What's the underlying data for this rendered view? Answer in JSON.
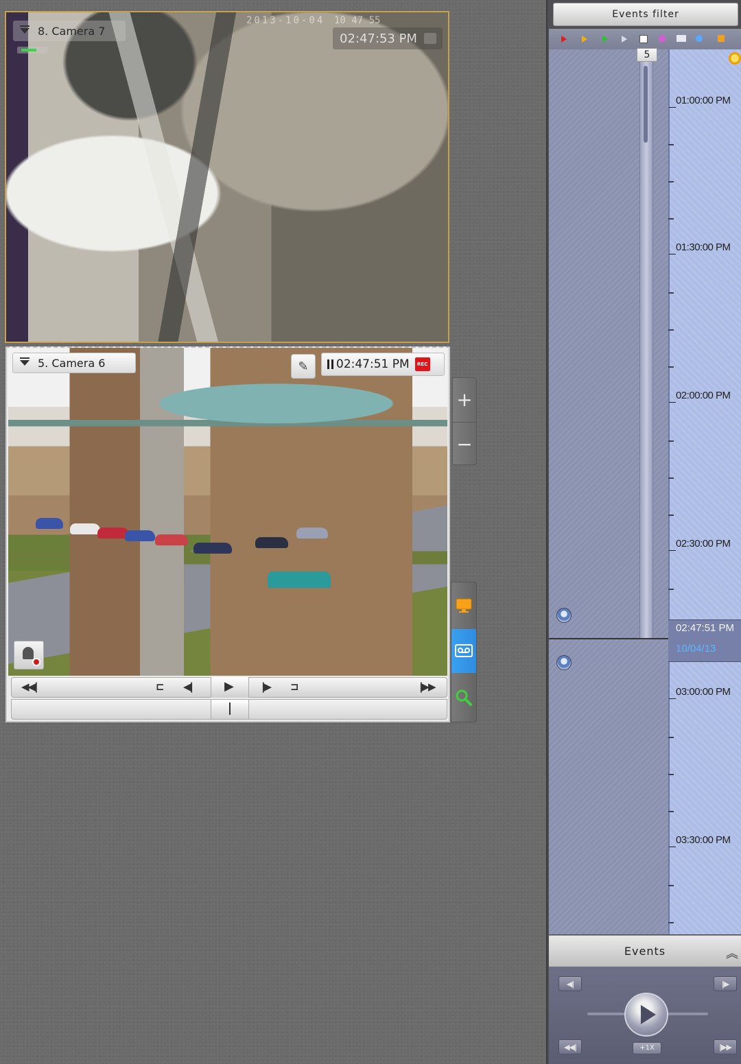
{
  "cameras": {
    "camera7": {
      "label": "8. Camera 7",
      "osd_date": "2013-10-04",
      "osd_time": "10 47 55",
      "time": "02:47:53 PM"
    },
    "camera6": {
      "label": "5. Camera 6",
      "time": "02:47:51 PM",
      "rec": "REC"
    }
  },
  "playback": {
    "buttons": [
      "rewind-to-start",
      "previous-fragment",
      "step-back",
      "play",
      "step-forward",
      "next-fragment",
      "fast-forward-to-end"
    ]
  },
  "side_tools": {
    "zoom_in": "+",
    "zoom_out": "−"
  },
  "timeline": {
    "filter_title": "Events filter",
    "badge": "5",
    "ticks": [
      "01:00:00 PM",
      "01:30:00 PM",
      "02:00:00 PM",
      "02:30:00 PM",
      "03:00:00 PM",
      "03:30:00 PM"
    ],
    "current_time": "02:47:51 PM",
    "current_date": "10/04/13"
  },
  "events_panel": {
    "title": "Events",
    "speed": "+1X"
  },
  "colors": {
    "active_mode": "#3aa0ef",
    "selected_border": "#c9a14a",
    "rec_red": "#e0151b",
    "timeline_bg": "#aebde6"
  }
}
